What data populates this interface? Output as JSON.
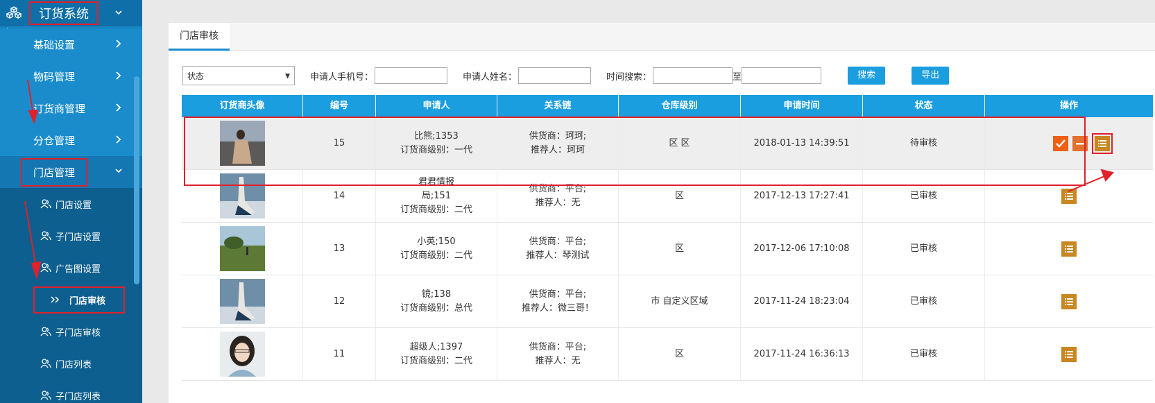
{
  "sidebar": {
    "title": "订货系统",
    "items": [
      {
        "label": "基础设置"
      },
      {
        "label": "物码管理"
      },
      {
        "label": "订货商管理"
      },
      {
        "label": "分仓管理"
      },
      {
        "label": "门店管理"
      }
    ],
    "subitems": [
      {
        "label": "门店设置"
      },
      {
        "label": "子门店设置"
      },
      {
        "label": "广告图设置"
      },
      {
        "label": "门店审核"
      },
      {
        "label": "子门店审核"
      },
      {
        "label": "门店列表"
      },
      {
        "label": "子门店列表"
      }
    ]
  },
  "tab": {
    "label": "门店审核"
  },
  "filters": {
    "status_placeholder": "状态",
    "phone_label": "申请人手机号：",
    "name_label": "申请人姓名：",
    "time_label": "时间搜索：",
    "to_label": "至",
    "search_button": "搜索",
    "export_button": "导出"
  },
  "table": {
    "headers": [
      "订货商头像",
      "编号",
      "申请人",
      "关系链",
      "仓库级别",
      "申请时间",
      "状态",
      "操作"
    ],
    "rows": [
      {
        "id": "15",
        "applicant": "比熊;1353",
        "level": "订货商级别：一代",
        "supplier": "供货商：珂珂;",
        "referrer": "推荐人：珂珂",
        "warehouse": "区 区",
        "time": "2018-01-13 14:39:51",
        "status": "待审核",
        "photo": "beach"
      },
      {
        "id": "14",
        "applicant_pre": "君君情报",
        "applicant": "局;151",
        "level": "订货商级别：二代",
        "supplier": "供货商：平台;",
        "referrer": "推荐人：无",
        "warehouse": "区",
        "time": "2017-12-13 17:27:41",
        "status": "已审核",
        "photo": "shoe"
      },
      {
        "id": "13",
        "applicant": "小英;150",
        "level": "订货商级别：二代",
        "supplier": "供货商：平台;",
        "referrer": "推荐人：琴测试",
        "warehouse": "区",
        "time": "2017-12-06 17:10:08",
        "status": "已审核",
        "photo": "grass"
      },
      {
        "id": "12",
        "applicant": "镜;138",
        "level": "订货商级别：总代",
        "supplier": "供货商：平台;",
        "referrer": "推荐人：微三哥！",
        "warehouse": "市 自定义区域",
        "time": "2017-11-24 18:23:04",
        "status": "已审核",
        "photo": "shoe"
      },
      {
        "id": "11",
        "applicant": "超级人;1397",
        "level": "订货商级别：二代",
        "supplier": "供货商：平台;",
        "referrer": "推荐人：无",
        "warehouse": "区",
        "time": "2017-11-24 16:36:13",
        "status": "已审核",
        "photo": "girl"
      }
    ]
  },
  "colors": {
    "accent": "#1a9ee0",
    "sidebar": "#1a84c2",
    "annotation": "#e0202a"
  }
}
